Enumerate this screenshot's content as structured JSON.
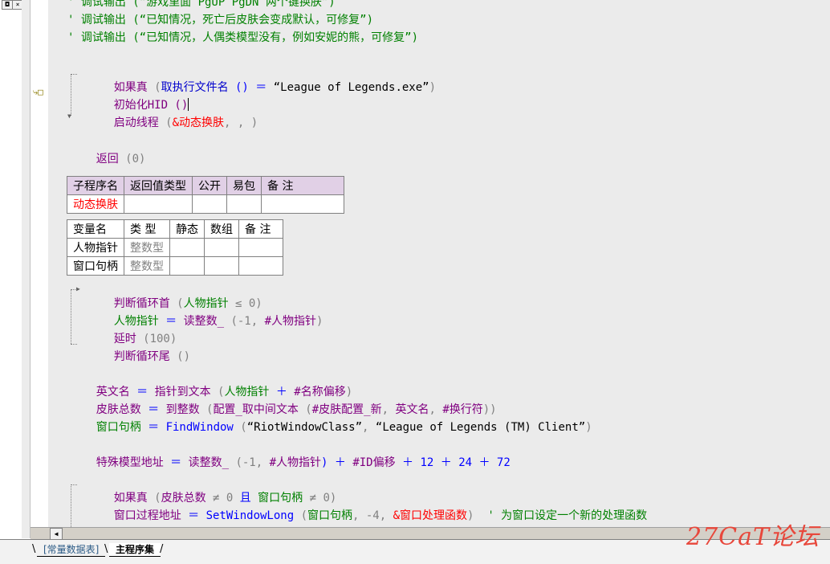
{
  "left_pane": {
    "btn_a": "◘",
    "btn_b": "×"
  },
  "code": {
    "comment1": "' 调试输出 (“游戏里面 PgUP PgDN 两个键换肤”)",
    "comment2": "' 调试输出 (“已知情况，死亡后皮肤会变成默认，可修复”)",
    "comment3": "' 调试输出 (“已知情况，人偶类模型没有，例如安妮的熊，可修复”)",
    "if1_kw": "如果真",
    "if1_open": " (",
    "if1_call": "取执行文件名",
    "if1_rest": " () ＝ ",
    "if1_str": "“League of Legends.exe”",
    "if1_close": ")",
    "init_hid": "初始化HID ()",
    "thread_call": "启动线程",
    "thread_open": " (",
    "thread_arg": "&动态换肤",
    "thread_rest": ", , )",
    "return_kw": "返回",
    "return_args": " (0)",
    "loop_head_kw": "判断循环首",
    "loop_head_open": " (",
    "loop_head_var": "人物指针",
    "loop_head_rest": " ≤ 0)",
    "assign1_var": "人物指针",
    "assign1_eq": " ＝ ",
    "assign1_call": "读整数_",
    "assign1_rest": " (-1, ",
    "assign1_arg": "#人物指针",
    "assign1_close": ")",
    "delay_kw": "延时",
    "delay_args": " (100)",
    "loop_tail_kw": "判断循环尾",
    "loop_tail_args": " ()",
    "en_name_var": "英文名",
    "en_name_eq": " ＝ ",
    "en_name_call": "指针到文本",
    "en_name_open": " (",
    "en_name_arg1": "人物指针",
    "en_name_plus": " ＋ ",
    "en_name_arg2": "#名称偏移",
    "en_name_close": ")",
    "skin_total_var": "皮肤总数",
    "skin_total_eq": " ＝ ",
    "skin_total_call1": "到整数",
    "skin_total_open": " (",
    "skin_total_call2": "配置_取中间文本",
    "skin_total_open2": " (",
    "skin_total_arg1": "#皮肤配置_新",
    "skin_total_sep1": ", ",
    "skin_total_arg2": "英文名",
    "skin_total_sep2": ", ",
    "skin_total_arg3": "#换行符",
    "skin_total_close": "))",
    "hwnd_var": "窗口句柄",
    "hwnd_eq": " ＝ ",
    "hwnd_call": "FindWindow",
    "hwnd_open": " (",
    "hwnd_str1": "“RiotWindowClass”",
    "hwnd_sep": ", ",
    "hwnd_str2": "“League of Legends (TM) Client”",
    "hwnd_close": ")",
    "special_var": "特殊模型地址",
    "special_eq": " ＝ ",
    "special_call": "读整数_",
    "special_open": " (-1, ",
    "special_arg1": "#人物指针",
    "special_mid": ") ＋ ",
    "special_arg2": "#ID偏移",
    "special_rest": " ＋ 12 ＋ 24 ＋ 72",
    "if2_kw": "如果真",
    "if2_open": " (",
    "if2_var1": "皮肤总数",
    "if2_mid": " ≠ 0 ",
    "if2_and": "且",
    "if2_space": " ",
    "if2_var2": "窗口句柄",
    "if2_rest": " ≠ 0)",
    "proc_var": "窗口过程地址",
    "proc_eq": " ＝ ",
    "proc_call": "SetWindowLong",
    "proc_open": " (",
    "proc_arg1": "窗口句柄",
    "proc_mid": ", -4, ",
    "proc_arg2": "&窗口处理函数",
    "proc_close": ")",
    "proc_comment": "  ' 为窗口设定一个新的处理函数"
  },
  "subroutine_table": {
    "headers": [
      "子程序名",
      "返回值类型",
      "公开",
      "易包",
      "备 注"
    ],
    "row": [
      "动态换肤",
      "",
      "",
      "",
      ""
    ]
  },
  "variable_table": {
    "headers": [
      "变量名",
      "类 型",
      "静态",
      "数组",
      "备 注"
    ],
    "rows": [
      [
        "人物指针",
        "整数型",
        "",
        "",
        ""
      ],
      [
        "窗口句柄",
        "整数型",
        "",
        "",
        ""
      ]
    ]
  },
  "scrollbar": {
    "left_arrow": "◀"
  },
  "tabs": [
    {
      "label": "[常量数据表]"
    },
    {
      "label": "主程序集"
    }
  ],
  "watermark": "27CaT论坛",
  "colors": {
    "editor_bg": "#ebebeb",
    "comment": "#008000",
    "keyword": "#800080",
    "call": "#0000cc",
    "table_header": "#e1d0e6",
    "watermark": "#e8473b"
  }
}
